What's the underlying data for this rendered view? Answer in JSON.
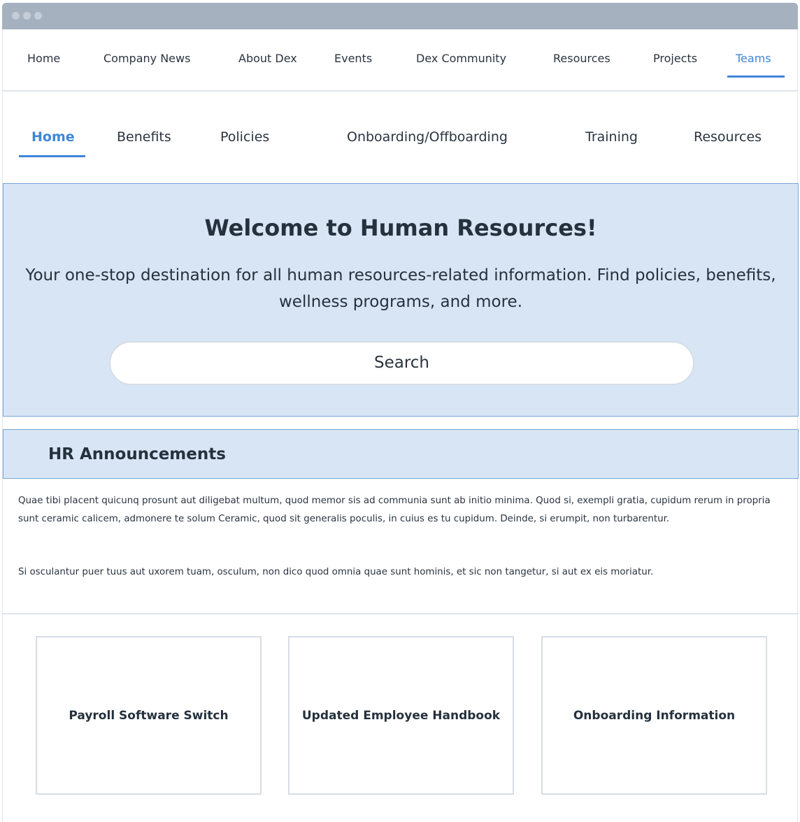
{
  "top_nav": {
    "items": [
      "Home",
      "Company News",
      "About Dex",
      "Events",
      "Dex Community",
      "Resources",
      "Projects",
      "Teams"
    ],
    "active": "Teams"
  },
  "sub_nav": {
    "items": [
      "Home",
      "Benefits",
      "Policies",
      "Onboarding/Offboarding",
      "Training",
      "Resources"
    ],
    "active": "Home"
  },
  "hero": {
    "title": "Welcome to Human Resources!",
    "subtitle": "Your one-stop destination for all human resources-related information. Find policies, benefits, wellness programs, and more.",
    "search_label": "Search"
  },
  "announcements": {
    "title": "HR Announcements",
    "paragraphs": [
      "Quae tibi placent quicunq prosunt aut diligebat multum, quod memor sis ad communia sunt ab initio minima. Quod si, exempli gratia, cupidum rerum in propria sunt ceramic calicem, admonere te solum Ceramic, quod sit generalis poculis, in cuius es tu cupidum. Deinde, si erumpit, non turbarentur.",
      "Si osculantur puer tuus aut uxorem tuam, osculum, non dico quod omnia quae sunt hominis, et sic non tangetur, si aut ex eis moriatur."
    ]
  },
  "cards": [
    {
      "label": "Payroll Software Switch"
    },
    {
      "label": "Updated Employee Handbook"
    },
    {
      "label": "Onboarding Information"
    }
  ],
  "colors": {
    "accent": "#3f86d9",
    "hero_bg": "#d8e5f4",
    "window_bar": "#a6b1bf"
  }
}
